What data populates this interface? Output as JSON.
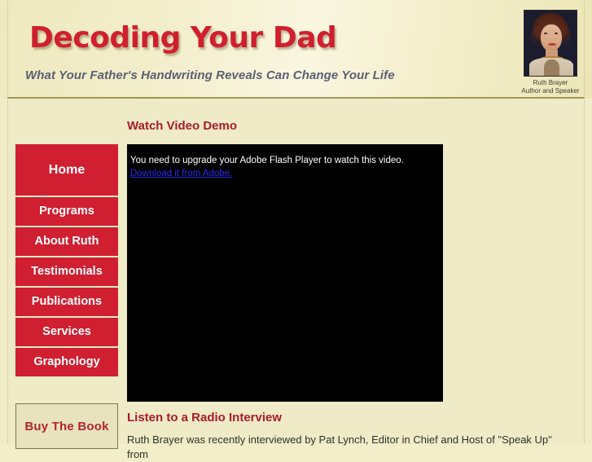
{
  "header": {
    "site_title": "Decoding Your Dad",
    "tagline": "What Your Father's Handwriting Reveals Can Change Your Life",
    "author_name": "Ruth Brayer",
    "author_role": "Author and Speaker",
    "photo_alt": "ruth-brayer-portrait"
  },
  "sidebar": {
    "items": [
      {
        "label": "Home"
      },
      {
        "label": "Programs"
      },
      {
        "label": "About Ruth"
      },
      {
        "label": "Testimonials"
      },
      {
        "label": "Publications"
      },
      {
        "label": "Services"
      },
      {
        "label": "Graphology"
      }
    ],
    "buy_button": "Buy The Book"
  },
  "main": {
    "video_heading": "Watch Video Demo",
    "flash_message": "You need to upgrade your Adobe Flash Player to watch this video.",
    "flash_link": "Download it from Adobe.",
    "radio_heading": "Listen to a Radio Interview",
    "radio_paragraph": "Ruth Brayer was recently interviewed by Pat Lynch, Editor in Chief and Host of \"Speak Up\" from"
  },
  "colors": {
    "page_background": "#f0ecc8",
    "nav_red": "#cf1f31",
    "title_red": "#d01f2d",
    "heading_red": "#a81b2c",
    "link_blue": "#2b2bee",
    "rule_olive": "#8e8849",
    "video_black": "#000000"
  }
}
